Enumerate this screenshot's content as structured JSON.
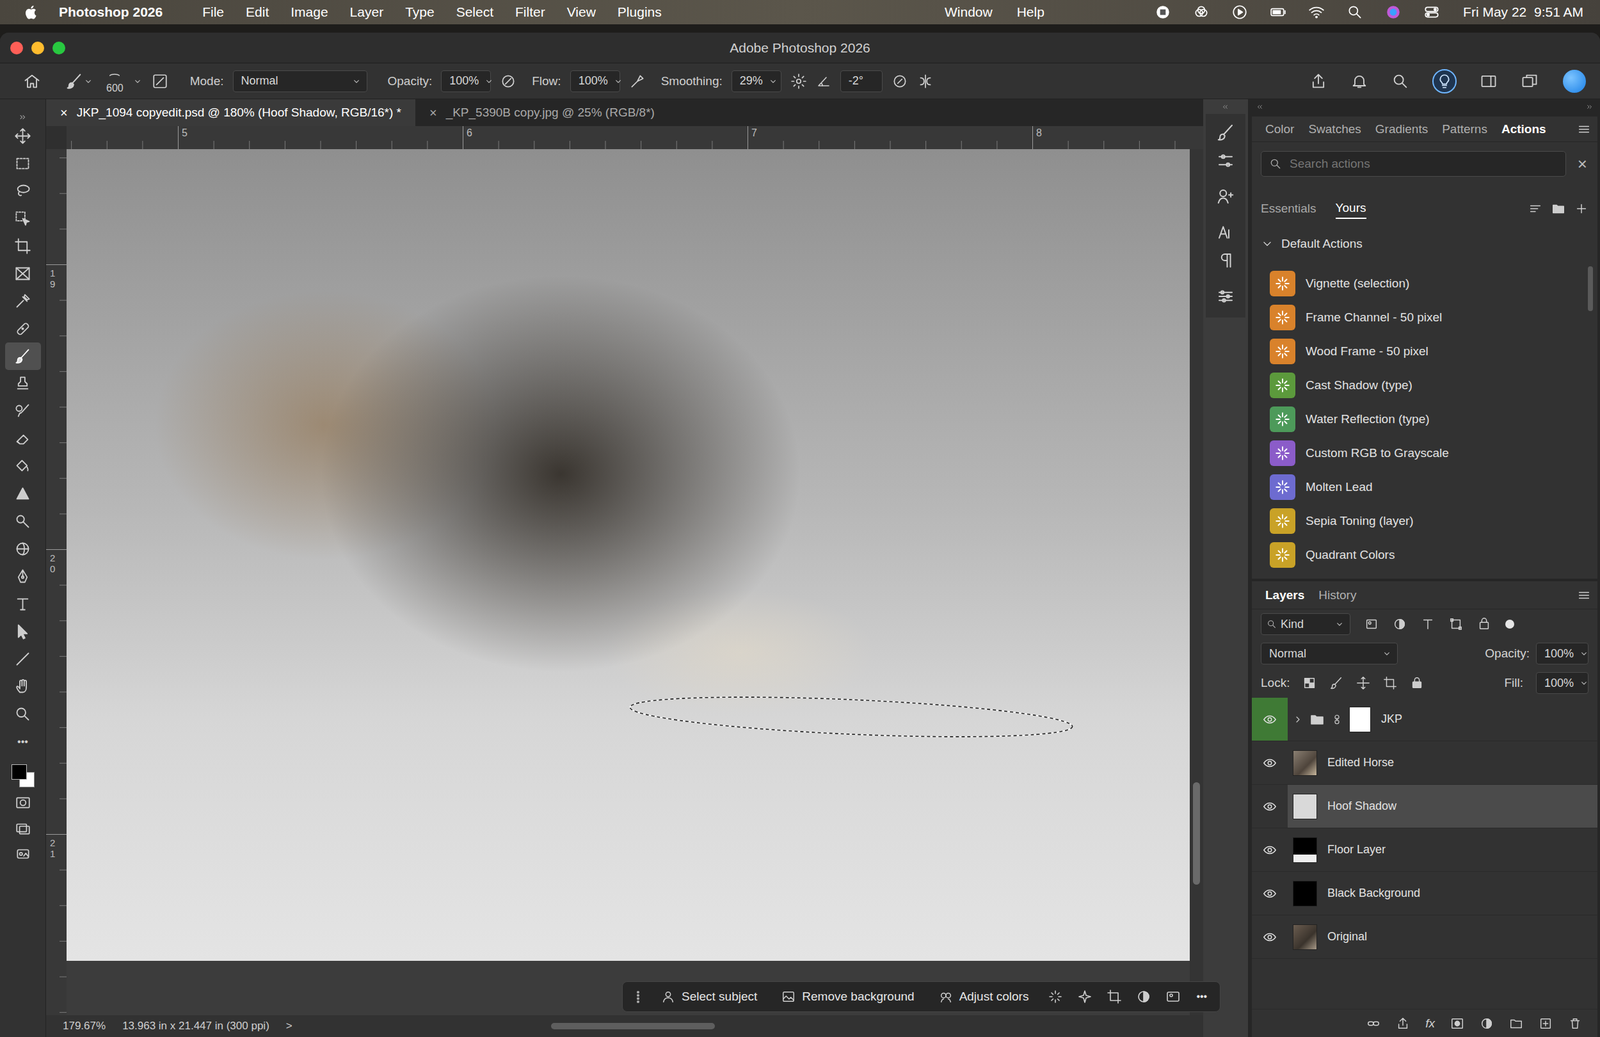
{
  "menubar": {
    "app": "Photoshop 2026",
    "items": [
      "File",
      "Edit",
      "Image",
      "Layer",
      "Type",
      "Select",
      "Filter",
      "View",
      "Plugins"
    ],
    "right_items": [
      "Window",
      "Help"
    ],
    "clock": "Fri May 22  9:51 AM"
  },
  "window": {
    "title": "Adobe Photoshop 2026"
  },
  "options": {
    "brush_size": "600",
    "mode_label": "Mode:",
    "mode": "Normal",
    "opacity_label": "Opacity:",
    "opacity": "100%",
    "flow_label": "Flow:",
    "flow": "100%",
    "smoothing_label": "Smoothing:",
    "smoothing": "29%",
    "angle": "-2°"
  },
  "doc_tabs": [
    {
      "label": "JKP_1094 copyedit.psd @ 180% (Hoof Shadow, RGB/16*) *",
      "selected": true,
      "close": "×"
    },
    {
      "label": "_KP_5390B copy.jpg @ 25% (RGB/8*)",
      "selected": false,
      "close": "×"
    }
  ],
  "rulers": {
    "top": [
      "5",
      "6",
      "7",
      "8"
    ],
    "left": [
      "19",
      "20",
      "21"
    ]
  },
  "toolbar": {
    "tools": [
      {
        "selected": false
      },
      {
        "selected": false
      },
      {
        "selected": false
      },
      {
        "selected": false
      },
      {
        "selected": false
      },
      {
        "selected": false
      },
      {
        "selected": false
      },
      {
        "selected": false
      },
      {
        "selected": true
      },
      {
        "selected": false
      },
      {
        "selected": false
      },
      {
        "selected": false
      },
      {
        "selected": false
      },
      {
        "selected": false
      },
      {
        "selected": false
      },
      {
        "selected": false
      },
      {
        "selected": false
      },
      {
        "selected": false
      },
      {
        "selected": false
      },
      {
        "selected": false
      },
      {
        "selected": false
      },
      {
        "selected": false
      }
    ],
    "more": "•••"
  },
  "canvas": {
    "scroll_vertical": {
      "level": 0.83
    }
  },
  "taskbar": {
    "buttons": [
      "Select subject",
      "Remove background",
      "Adjust colors"
    ],
    "more": "•••"
  },
  "status_bar": {
    "zoom": "179.67%",
    "doc_size": "13.963 in x 21.447 in (300 ppi)",
    "arrow": ">",
    "scroll_horizontal": {
      "level": 0.4
    }
  },
  "panel_tabs": [
    {
      "label": "Color",
      "selected": false
    },
    {
      "label": "Swatches",
      "selected": false
    },
    {
      "label": "Gradients",
      "selected": false
    },
    {
      "label": "Patterns",
      "selected": false
    },
    {
      "label": "Actions",
      "selected": true
    }
  ],
  "actions": {
    "search_placeholder": "Search actions",
    "clear": "×",
    "subtabs": [
      {
        "label": "Essentials",
        "selected": false
      },
      {
        "label": "Yours",
        "selected": true
      }
    ],
    "set": {
      "name": "Default Actions",
      "expanded": true
    },
    "items": [
      {
        "name": "Vignette (selection)",
        "color": "#d9822b"
      },
      {
        "name": "Frame Channel - 50 pixel",
        "color": "#d9822b"
      },
      {
        "name": "Wood Frame - 50 pixel",
        "color": "#d9822b"
      },
      {
        "name": "Cast Shadow (type)",
        "color": "#5c9a3c"
      },
      {
        "name": "Water Reflection (type)",
        "color": "#4d9a5a"
      },
      {
        "name": "Custom RGB to Grayscale",
        "color": "#8b5cc9"
      },
      {
        "name": "Molten Lead",
        "color": "#6d6bd0"
      },
      {
        "name": "Sepia Toning (layer)",
        "color": "#c9a227"
      },
      {
        "name": "Quadrant Colors",
        "color": "#c9a227"
      }
    ],
    "scroll": {
      "level": 0
    }
  },
  "layers_tabs": [
    {
      "label": "Layers",
      "selected": true
    },
    {
      "label": "History",
      "selected": false
    }
  ],
  "layers": {
    "filter": "Kind",
    "blend": "Normal",
    "opacity_label": "Opacity:",
    "opacity": "100%",
    "lock_label": "Lock:",
    "fill_label": "Fill:",
    "fill": "100%",
    "fx": "fx",
    "rows": [
      {
        "name": "JKP",
        "kind": "group",
        "visible": true,
        "selected": false,
        "label_color": "#3f7a35"
      },
      {
        "name": "Edited Horse",
        "kind": "layer",
        "visible": true,
        "selected": false,
        "label_color": "none"
      },
      {
        "name": "Hoof Shadow",
        "kind": "layer",
        "visible": true,
        "selected": true,
        "label_color": "none"
      },
      {
        "name": "Floor Layer",
        "kind": "layer",
        "visible": true,
        "selected": false,
        "label_color": "none"
      },
      {
        "name": "Black Background",
        "kind": "layer",
        "visible": true,
        "selected": false,
        "label_color": "none"
      },
      {
        "name": "Original",
        "kind": "layer",
        "visible": true,
        "selected": false,
        "label_color": "none"
      }
    ]
  }
}
